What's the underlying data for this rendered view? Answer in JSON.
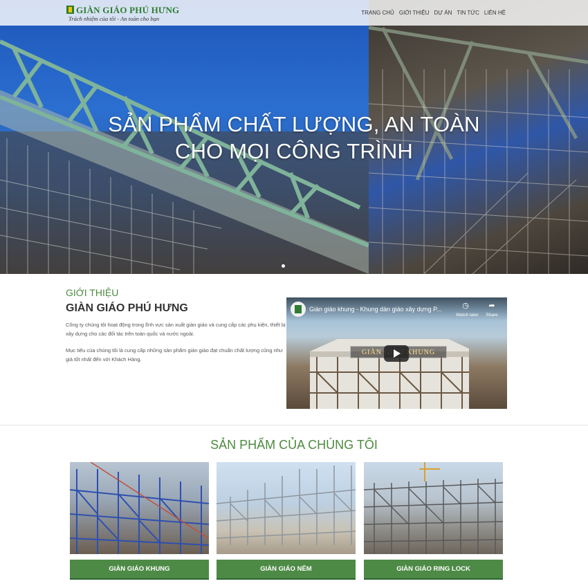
{
  "header": {
    "logo": {
      "name": "GIÀN GIÁO PHÚ HƯNG",
      "tagline": "Trách nhiệm của tôi - An toàn cho bạn"
    },
    "nav": [
      "TRANG CHỦ",
      "GIỚI THIỆU",
      "DỰ ÁN",
      "TIN TỨC",
      "LIÊN HỆ"
    ]
  },
  "hero": {
    "title_line1": "SẢN PHẨM CHẤT LƯỢNG, AN TOÀN",
    "title_line2": "CHO MỌI CÔNG TRÌNH"
  },
  "intro": {
    "label": "GIỚI THIỆU",
    "title": "GIÀN GIÁO PHÚ HƯNG",
    "paragraph1": "Công ty chúng tôi hoạt động trong lĩnh vực sản xuất giàn giáo và cung cấp các phụ kiện, thiết bị xây dựng cho các đối tác trên toàn quốc và nước ngoài.",
    "paragraph2": "Mục tiêu của chúng tôi là cung cấp những sản phẩm giàn giáo đạt chuẩn chất lượng cũng như giá tốt nhất đến với Khách Hàng.",
    "video": {
      "title": "Giàn giáo khung - Khung dàn giáo xây dựng P...",
      "watch_later": "Watch later",
      "share": "Share",
      "banner": "GIÀN GIÁO KHUNG"
    }
  },
  "products": {
    "title": "SẢN PHẨM CỦA CHÚNG TÔI",
    "items": [
      {
        "label": "GIÀN GIÁO KHUNG"
      },
      {
        "label": "GIÀN GIÁO NÊM"
      },
      {
        "label": "GIÀN GIÁO RING LOCK"
      }
    ]
  },
  "colors": {
    "brand_green": "#4d8a46",
    "heading_green": "#4c8a3f",
    "logo_yellow": "#f2c500"
  }
}
